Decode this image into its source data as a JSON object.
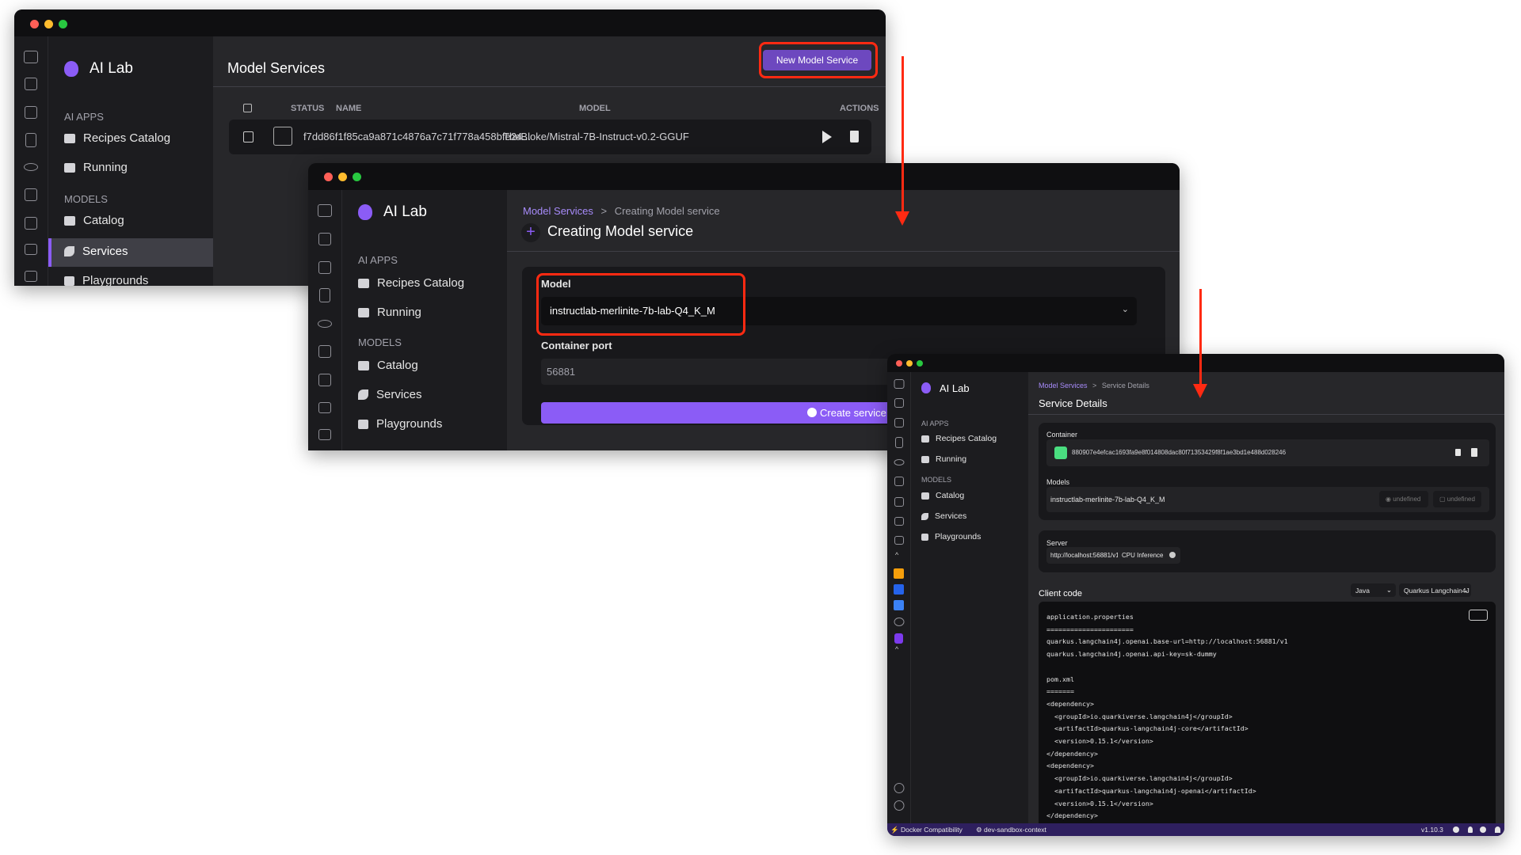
{
  "app_name": "AI Lab",
  "sidebar": {
    "ai_apps": "AI APPS",
    "recipes": "Recipes Catalog",
    "running": "Running",
    "models": "MODELS",
    "catalog": "Catalog",
    "services": "Services",
    "playgrounds": "Playgrounds"
  },
  "w1": {
    "title": "Model Services",
    "new_button": "New Model Service",
    "columns": {
      "status": "STATUS",
      "name": "NAME",
      "model": "MODEL",
      "actions": "ACTIONS"
    },
    "row": {
      "name": "f7dd86f1f85ca9a871c4876a7c71f778a458bfe24...",
      "model": "TheBloke/Mistral-7B-Instruct-v0.2-GGUF"
    }
  },
  "w2": {
    "breadcrumb_link": "Model Services",
    "breadcrumb_sep": ">",
    "breadcrumb_current": "Creating Model service",
    "title": "Creating Model service",
    "model_label": "Model",
    "model_value": "instructlab-merlinite-7b-lab-Q4_K_M",
    "port_label": "Container port",
    "port_value": "56881",
    "create_button": "Create service"
  },
  "w3": {
    "breadcrumb_link": "Model Services",
    "breadcrumb_sep": ">",
    "breadcrumb_current": "Service Details",
    "title": "Service Details",
    "container_label": "Container",
    "container_id": "880907e4efcac1693fa9e8f014808dac80f71353429f8f1ae3bd1e488d028246",
    "models_label": "Models",
    "model_name": "instructlab-merlinite-7b-lab-Q4_K_M",
    "badge1": "undefined",
    "badge2": "undefined",
    "server_label": "Server",
    "server_url": "http://localhost:56881/v1",
    "inference": "CPU Inference",
    "client_code_label": "Client code",
    "language": "Java",
    "framework": "Quarkus Langchain4J",
    "code_lines": [
      "application.properties",
      "======================",
      "quarkus.langchain4j.openai.base-url=http://localhost:56881/v1",
      "quarkus.langchain4j.openai.api-key=sk-dummy",
      "",
      "pom.xml",
      "=======",
      "<dependency>",
      "  <groupId>io.quarkiverse.langchain4j</groupId>",
      "  <artifactId>quarkus-langchain4j-core</artifactId>",
      "  <version>0.15.1</version>",
      "</dependency>",
      "<dependency>",
      "  <groupId>io.quarkiverse.langchain4j</groupId>",
      "  <artifactId>quarkus-langchain4j-openai</artifactId>",
      "  <version>0.15.1</version>",
      "</dependency>"
    ],
    "status_bar": {
      "docker": "Docker Compatibility",
      "context": "dev-sandbox-context",
      "version": "v1.10.3"
    }
  },
  "colors": {
    "accent": "#8b5cf6",
    "button": "#6d48bf",
    "annotation": "#ff2a12",
    "statusbar": "#2e1f5e"
  }
}
